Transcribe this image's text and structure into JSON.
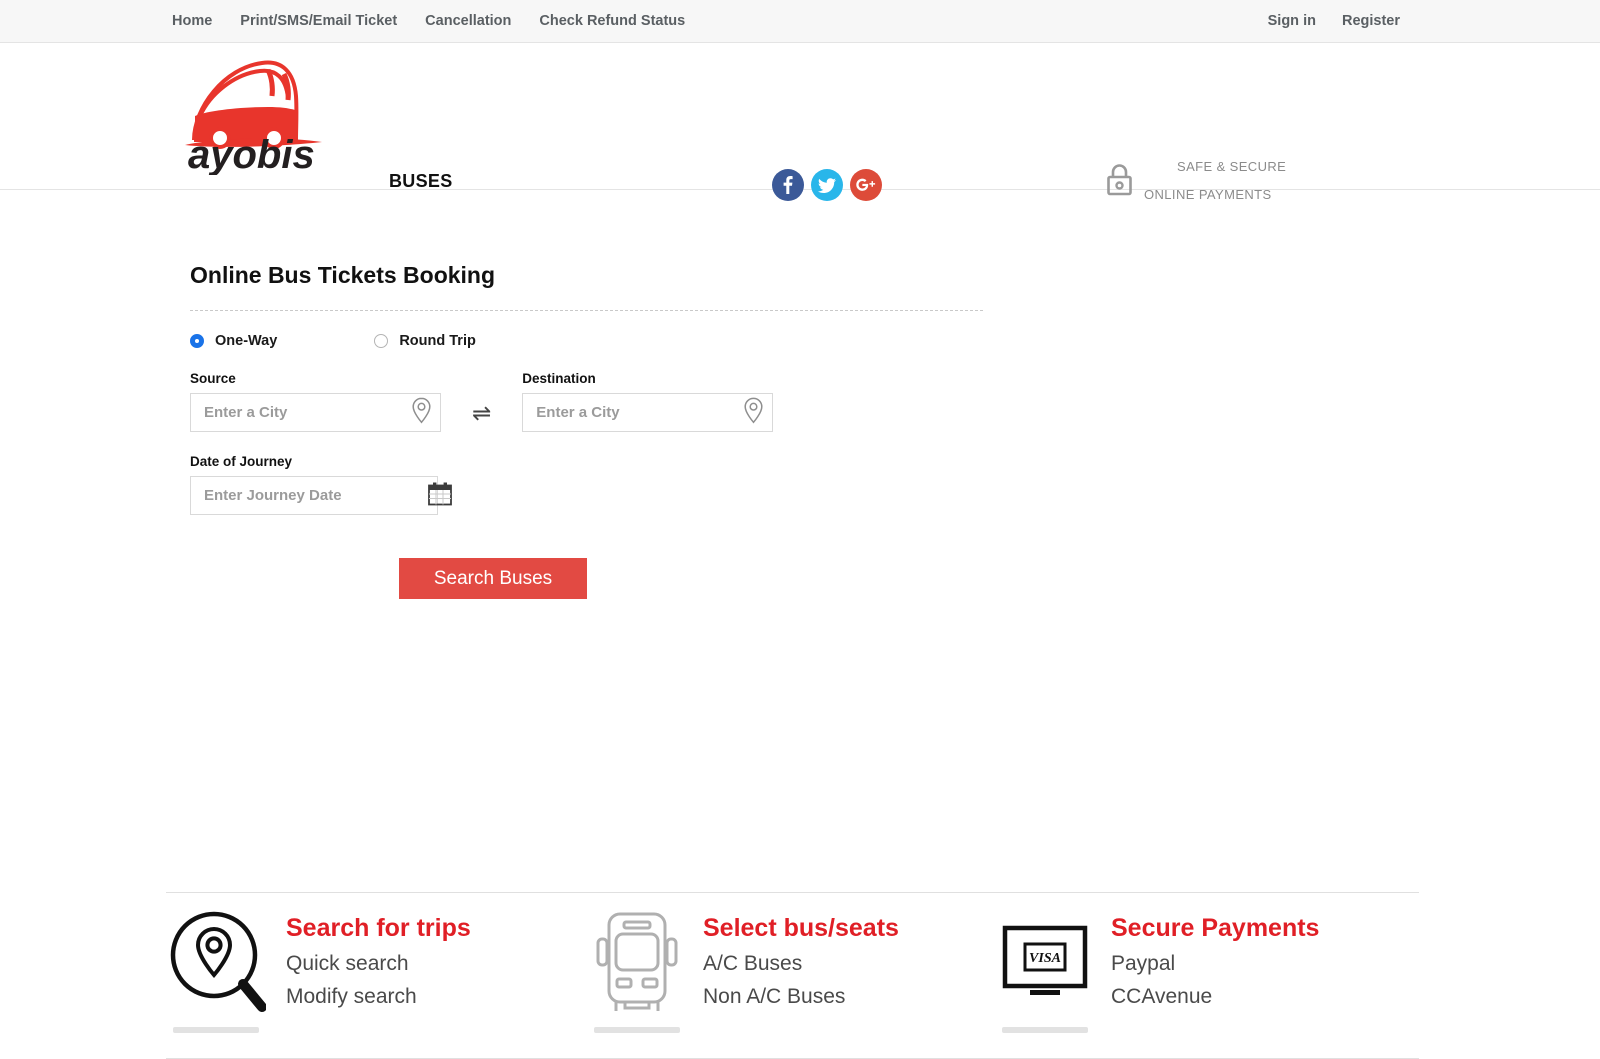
{
  "topbar": {
    "links": [
      {
        "label": "Home",
        "name": "nav-home"
      },
      {
        "label": "Print/SMS/Email Ticket",
        "name": "nav-print-sms-email-ticket"
      },
      {
        "label": "Cancellation",
        "name": "nav-cancellation"
      },
      {
        "label": "Check Refund Status",
        "name": "nav-check-refund-status"
      }
    ],
    "sign_in": "Sign in",
    "register": "Register"
  },
  "header": {
    "logo_text": "ayobis",
    "logo_icon": "bus-logo-icon",
    "section_label": "BUSES",
    "social": [
      {
        "name": "facebook-icon",
        "label": "f",
        "color": "#3b5998"
      },
      {
        "name": "twitter-icon",
        "label": "",
        "color": "#29b6ea"
      },
      {
        "name": "google-plus-icon",
        "label": "g+",
        "color": "#dd4b39"
      }
    ],
    "secure": {
      "icon": "lock-icon",
      "line1": "SAFE & SECURE",
      "line2": "ONLINE PAYMENTS"
    }
  },
  "booking": {
    "title": "Online Bus Tickets Booking",
    "trip_types": [
      {
        "label": "One-Way",
        "selected": true
      },
      {
        "label": "Round Trip",
        "selected": false
      }
    ],
    "source": {
      "label": "Source",
      "placeholder": "Enter a City",
      "value": "",
      "icon": "map-pin-icon"
    },
    "destination": {
      "label": "Destination",
      "placeholder": "Enter a City",
      "value": "",
      "icon": "map-pin-icon"
    },
    "swap_icon": "swap-arrows-icon",
    "date": {
      "label": "Date of Journey",
      "placeholder": "Enter Journey Date",
      "value": "",
      "icon": "calendar-icon"
    },
    "search_button": "Search Buses",
    "accent_color": "#e24a43"
  },
  "features": [
    {
      "icon": "search-location-icon",
      "title": "Search for trips",
      "line1": "Quick search",
      "line2": "Modify search"
    },
    {
      "icon": "bus-front-icon",
      "title": "Select bus/seats",
      "line1": "A/C Buses",
      "line2": "Non A/C Buses"
    },
    {
      "icon": "monitor-visa-icon",
      "title": "Secure Payments",
      "line1": "Paypal",
      "line2": "CCAvenue"
    }
  ],
  "feature_title_color": "#e01f26"
}
